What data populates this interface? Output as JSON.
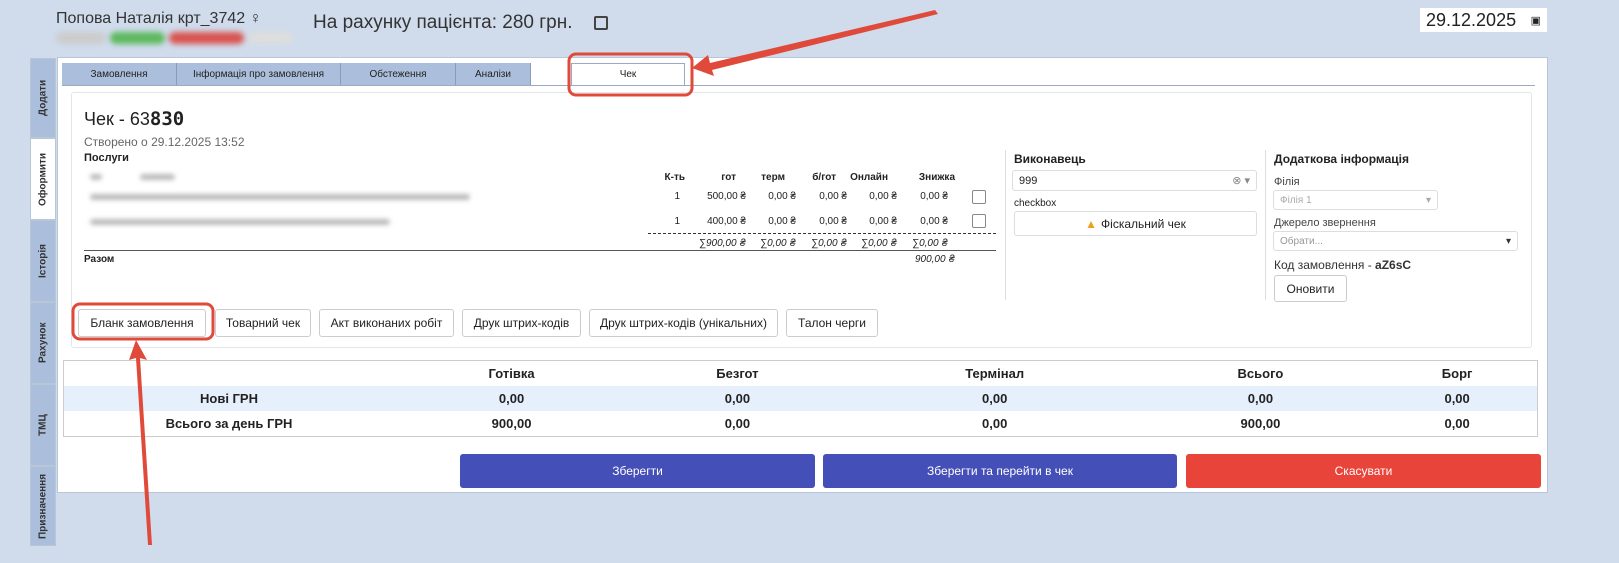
{
  "header": {
    "patient": "Попова Наталія крт_3742 ♀",
    "balance": "На рахунку пацієнта: 280 грн.",
    "date": "29.12.2025"
  },
  "side_tabs": [
    "Додати",
    "Оформити",
    "Історія",
    "Рахунок",
    "ТМЦ",
    "Призначення"
  ],
  "tabs": [
    "Замовлення",
    "Інформація про замовлення",
    "Обстеження",
    "Аналізи",
    "Чек"
  ],
  "receipt": {
    "title_prefix": "Чек - 63",
    "title_number": "830",
    "created": "Створено о 29.12.2025 13:52",
    "services_label": "Послуги",
    "columns": [
      "К-ть",
      "гот",
      "терм",
      "б/гот",
      "Онлайн",
      "Знижка"
    ],
    "rows": [
      [
        "1",
        "500,00 ₴",
        "0,00 ₴",
        "0,00 ₴",
        "0,00 ₴",
        "0,00 ₴"
      ],
      [
        "1",
        "400,00 ₴",
        "0,00 ₴",
        "0,00 ₴",
        "0,00 ₴",
        "0,00 ₴"
      ]
    ],
    "sums": [
      "∑900,00 ₴",
      "∑0,00 ₴",
      "∑0,00 ₴",
      "∑0,00 ₴",
      "∑0,00 ₴"
    ],
    "total_label": "Разом",
    "total": "900,00 ₴"
  },
  "executor": {
    "label": "Виконавець",
    "value": "999",
    "checkbox_label": "checkbox",
    "fiscal_button": "Фіскальний чек"
  },
  "extra": {
    "label": "Додаткова інформація",
    "branch_label": "Філія",
    "branch_value": "Філія 1",
    "source_label": "Джерело звернення",
    "source_placeholder": "Обрати...",
    "code_label": "Код замовлення - ",
    "code": "aZ6sC",
    "refresh": "Оновити"
  },
  "actions": [
    "Бланк замовлення",
    "Товарний чек",
    "Акт виконаних робіт",
    "Друк штрих-кодів",
    "Друк штрих-кодів (унікальних)",
    "Талон черги"
  ],
  "totals": {
    "headers": [
      "",
      "Готівка",
      "Безгот",
      "Термінал",
      "Всього",
      "Борг"
    ],
    "rows": [
      [
        "Нові ГРН",
        "0,00",
        "0,00",
        "0,00",
        "0,00",
        "0,00"
      ],
      [
        "Всього за день ГРН",
        "900,00",
        "0,00",
        "0,00",
        "900,00",
        "0,00"
      ]
    ]
  },
  "buttons": {
    "save": "Зберегти",
    "save_go": "Зберегти та перейти в чек",
    "cancel": "Скасувати"
  },
  "colors": {
    "primary": "#4450b8",
    "danger": "#e8443a",
    "annotation": "#e04a3a"
  }
}
